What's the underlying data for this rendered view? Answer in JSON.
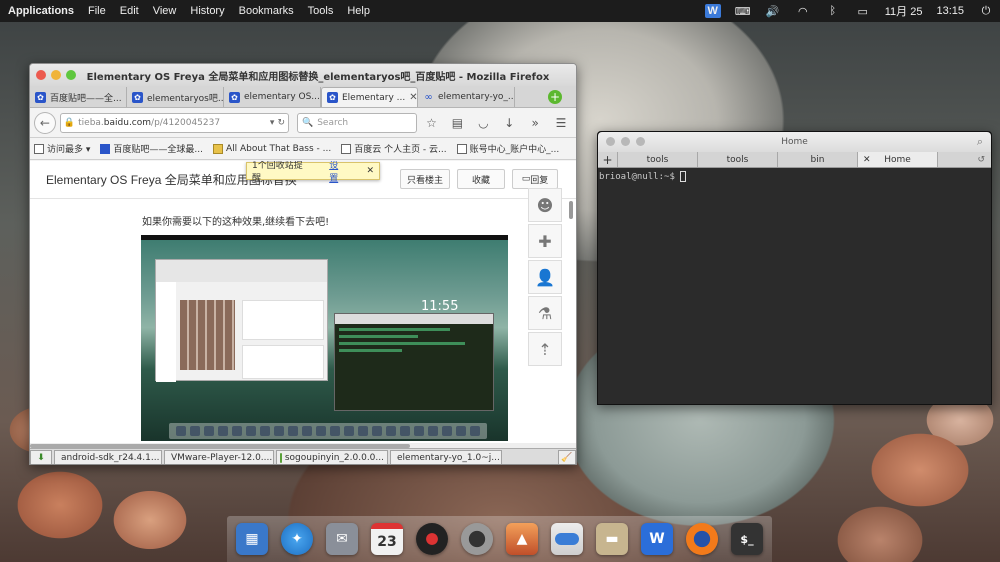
{
  "topbar": {
    "applications": "Applications",
    "menus": [
      "File",
      "Edit",
      "View",
      "History",
      "Bookmarks",
      "Tools",
      "Help"
    ],
    "wps": "W",
    "date": "11月 25",
    "time": "13:15"
  },
  "firefox": {
    "title": "Elementary OS Freya 全局菜单和应用图标替换_elementaryos吧_百度贴吧 - Mozilla Firefox",
    "tabs": [
      "百度贴吧——全...",
      "elementaryos吧...",
      "elementary OS...",
      "Elementary ...",
      "elementary-yo_..."
    ],
    "url_path": "tieba.",
    "url_domain": "baidu.com",
    "url_rest": "/p/4120045237",
    "search_placeholder": "Search",
    "bookmarks": [
      "访问最多 ▾",
      "百度贴吧——全球最...",
      "All About That Bass - ...",
      "百度云 个人主页 - 云...",
      "账号中心_账户中心_..."
    ],
    "page": {
      "title": "Elementary OS Freya 全局菜单和应用图标替换",
      "btn_louzhu": "只看楼主",
      "btn_collect": "收藏",
      "btn_reply": "回复",
      "popup_text": "1个回收站提醒",
      "popup_link": "设置",
      "popup_close": "✕",
      "intro": "如果你需要以下的这种效果,继续看下去吧!",
      "shot_clock": "11:55"
    },
    "downloads": [
      "android-sdk_r24.4.1...",
      "VMware-Player-12.0....",
      "sogoupinyin_2.0.0.0...",
      "elementary-yo_1.0~j..."
    ]
  },
  "terminal": {
    "title": "Home",
    "tabs": [
      "tools",
      "tools",
      "bin",
      "Home"
    ],
    "prompt": "brioal@null:~$ "
  },
  "dock": {
    "calendar_day": "23",
    "wps": "W",
    "terminal": "$_"
  }
}
